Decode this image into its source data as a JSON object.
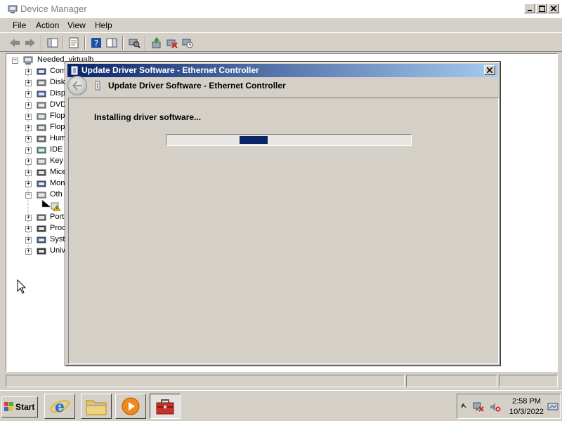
{
  "window": {
    "title": "Device Manager",
    "menu": [
      "File",
      "Action",
      "View",
      "Help"
    ]
  },
  "toolbar": {
    "icons": [
      "back-icon",
      "forward-icon",
      "show-hide-console-tree-icon",
      "properties-icon",
      "help-icon",
      "action-pane-icon",
      "scan-hardware-icon",
      "update-driver-icon",
      "uninstall-icon",
      "disable-icon"
    ]
  },
  "tree": {
    "root": "Needed_virtualb",
    "items": [
      {
        "label": "Com",
        "icon": "computer-icon",
        "expanded": false
      },
      {
        "label": "Disk",
        "icon": "disk-drive-icon",
        "expanded": false
      },
      {
        "label": "Disp",
        "icon": "display-adapter-icon",
        "expanded": false
      },
      {
        "label": "DVD",
        "icon": "dvd-drive-icon",
        "expanded": false
      },
      {
        "label": "Flop",
        "icon": "floppy-controller-icon",
        "expanded": false
      },
      {
        "label": "Flop",
        "icon": "floppy-drive-icon",
        "expanded": false
      },
      {
        "label": "Hum",
        "icon": "human-interface-icon",
        "expanded": false
      },
      {
        "label": "IDE",
        "icon": "ide-controller-icon",
        "expanded": false
      },
      {
        "label": "Key",
        "icon": "keyboard-icon",
        "expanded": false
      },
      {
        "label": "Mice",
        "icon": "mouse-icon",
        "expanded": false
      },
      {
        "label": "Mon",
        "icon": "monitor-icon",
        "expanded": false
      },
      {
        "label": "Oth",
        "icon": "other-devices-icon",
        "expanded": true
      },
      {
        "label": "",
        "icon": "unknown-device-warning-icon",
        "child": true
      },
      {
        "label": "Port",
        "icon": "ports-icon",
        "expanded": false
      },
      {
        "label": "Proc",
        "icon": "processor-icon",
        "expanded": false
      },
      {
        "label": "Syst",
        "icon": "system-devices-icon",
        "expanded": false
      },
      {
        "label": "Univ",
        "icon": "usb-controller-icon",
        "expanded": false
      }
    ]
  },
  "dialog": {
    "title": "Update Driver Software - Ethernet Controller",
    "header": "Update Driver Software - Ethernet Controller",
    "status": "Installing driver software...",
    "progress": "indeterminate"
  },
  "taskbar": {
    "start_label": "Start",
    "apps": [
      "internet-explorer-icon",
      "windows-explorer-icon",
      "media-player-icon",
      "device-manager-toolbox-icon"
    ],
    "active_app": "device-manager-toolbox-icon",
    "time": "2:58 PM",
    "date": "10/3/2022",
    "tray_icons": [
      "show-hidden-icons-chevron",
      "network-disconnected-icon",
      "volume-muted-icon",
      "action-center-icon"
    ]
  },
  "colors": {
    "dialog_title_start": "#0a246a",
    "dialog_title_end": "#a6caf0",
    "progress_fill": "#0a246a",
    "chrome": "#d4d0c8"
  }
}
